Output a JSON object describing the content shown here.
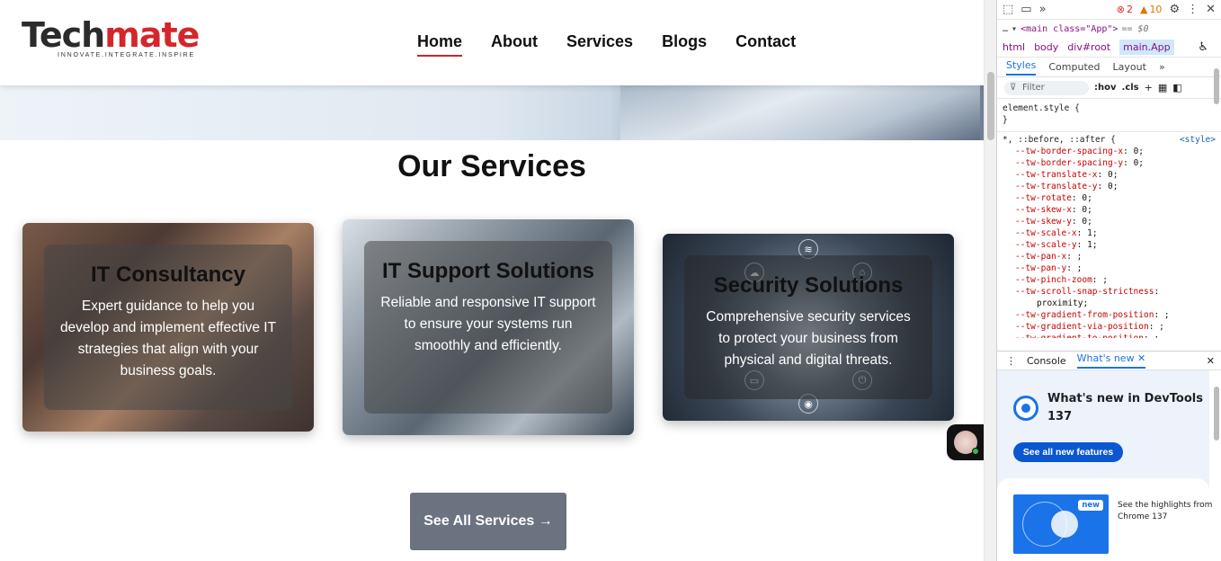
{
  "site": {
    "logo": {
      "word_dark": "Tech",
      "word_red": "mate",
      "tagline": "INNOVATE.INTEGRATE.INSPIRE"
    },
    "nav": [
      {
        "label": "Home",
        "active": true
      },
      {
        "label": "About",
        "active": false
      },
      {
        "label": "Services",
        "active": false
      },
      {
        "label": "Blogs",
        "active": false
      },
      {
        "label": "Contact",
        "active": false
      }
    ],
    "section_title": "Our Services",
    "cards": [
      {
        "title": "IT Consultancy",
        "description": "Expert guidance to help you develop and implement effective IT strategies that align with your business goals."
      },
      {
        "title": "IT Support Solutions",
        "description": "Reliable and responsive IT support to ensure your systems run smoothly and efficiently."
      },
      {
        "title": "Security Solutions",
        "description": "Comprehensive security services to protect your business from physical and digital threats."
      }
    ],
    "cta_label": "See All Services →"
  },
  "devtools": {
    "errors": "2",
    "warnings": "10",
    "selected_element": "<main class=\"App\">",
    "selected_suffix": "== $0",
    "breadcrumbs": [
      "html",
      "body",
      "div#root",
      "main.App"
    ],
    "panel_tabs": [
      "Styles",
      "Computed",
      "Layout"
    ],
    "filter_placeholder": "Filter",
    "filter_tools": [
      ":hov",
      ".cls"
    ],
    "element_style": "element.style {",
    "element_style_close": "}",
    "rule_selector": "*, ::before, ::after {",
    "rule_source": "<style>",
    "properties": [
      {
        "name": "--tw-border-spacing-x",
        "value": "0;"
      },
      {
        "name": "--tw-border-spacing-y",
        "value": "0;"
      },
      {
        "name": "--tw-translate-x",
        "value": "0;"
      },
      {
        "name": "--tw-translate-y",
        "value": "0;"
      },
      {
        "name": "--tw-rotate",
        "value": "0;"
      },
      {
        "name": "--tw-skew-x",
        "value": "0;"
      },
      {
        "name": "--tw-skew-y",
        "value": "0;"
      },
      {
        "name": "--tw-scale-x",
        "value": "1;"
      },
      {
        "name": "--tw-scale-y",
        "value": "1;"
      },
      {
        "name": "--tw-pan-x",
        "value": ";"
      },
      {
        "name": "--tw-pan-y",
        "value": ";"
      },
      {
        "name": "--tw-pinch-zoom",
        "value": ";"
      },
      {
        "name": "--tw-scroll-snap-strictness",
        "value": ""
      },
      {
        "name": "",
        "value": "proximity;"
      },
      {
        "name": "--tw-gradient-from-position",
        "value": ";"
      },
      {
        "name": "--tw-gradient-via-position",
        "value": ";"
      },
      {
        "name": "--tw-gradient-to-position",
        "value": ";"
      }
    ],
    "drawer_tabs": [
      "Console",
      "What's new"
    ],
    "whats_new_title": "What's new in DevTools 137",
    "whats_new_button": "See all new features",
    "whats_new_badge": "new",
    "whats_new_card_text": "See the highlights from Chrome 137"
  },
  "colors": {
    "brand_red": "#d4262b",
    "cta_gray": "#6b7280",
    "devtools_blue": "#1a73e8"
  }
}
